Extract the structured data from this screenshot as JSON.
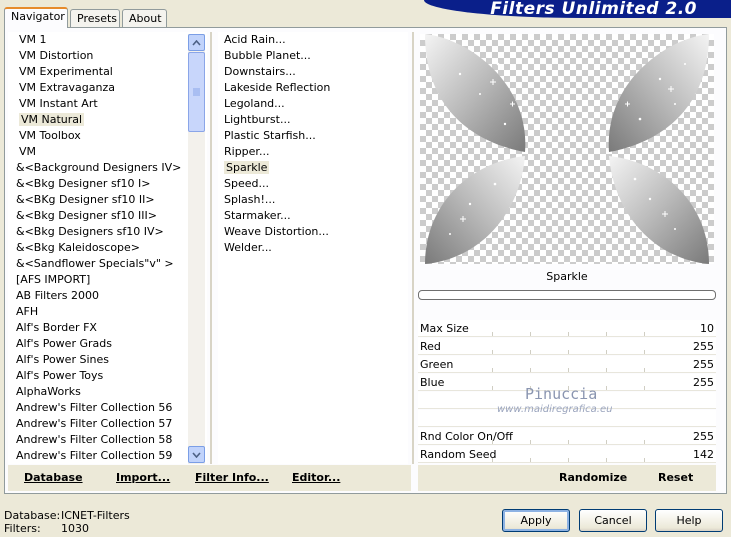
{
  "window": {
    "banner_title": "Filters Unlimited 2.0"
  },
  "tabs": [
    {
      "label": "Navigator",
      "active": true
    },
    {
      "label": "Presets",
      "active": false
    },
    {
      "label": "About",
      "active": false
    }
  ],
  "categories": {
    "items": [
      {
        "label": "VM 1"
      },
      {
        "label": "VM Distortion"
      },
      {
        "label": "VM Experimental"
      },
      {
        "label": "VM Extravaganza"
      },
      {
        "label": "VM Instant Art"
      },
      {
        "label": "VM Natural",
        "selected": true
      },
      {
        "label": "VM Toolbox"
      },
      {
        "label": "VM"
      },
      {
        "label": "&<Background Designers IV>"
      },
      {
        "label": "&<Bkg Designer sf10 I>"
      },
      {
        "label": "&<BKg Designer sf10 II>"
      },
      {
        "label": "&<Bkg Designer sf10 III>"
      },
      {
        "label": "&<Bkg Designers sf10 IV>"
      },
      {
        "label": "&<Bkg Kaleidoscope>"
      },
      {
        "label": "&<Sandflower Specials\"v\" >"
      },
      {
        "label": "[AFS IMPORT]"
      },
      {
        "label": "AB Filters 2000"
      },
      {
        "label": "AFH"
      },
      {
        "label": "Alf's Border FX"
      },
      {
        "label": "Alf's Power Grads"
      },
      {
        "label": "Alf's Power Sines"
      },
      {
        "label": "Alf's Power Toys"
      },
      {
        "label": "AlphaWorks"
      },
      {
        "label": "Andrew's Filter Collection 56"
      },
      {
        "label": "Andrew's Filter Collection 57"
      },
      {
        "label": "Andrew's Filter Collection 58"
      },
      {
        "label": "Andrew's Filter Collection 59"
      }
    ]
  },
  "filters": {
    "items": [
      {
        "label": "Acid Rain..."
      },
      {
        "label": "Bubble Planet..."
      },
      {
        "label": "Downstairs..."
      },
      {
        "label": "Lakeside Reflection"
      },
      {
        "label": "Legoland..."
      },
      {
        "label": "Lightburst..."
      },
      {
        "label": "Plastic Starfish..."
      },
      {
        "label": "Ripper..."
      },
      {
        "label": "Sparkle",
        "selected": true
      },
      {
        "label": "Speed..."
      },
      {
        "label": "Splash!..."
      },
      {
        "label": "Starmaker..."
      },
      {
        "label": "Weave Distortion..."
      },
      {
        "label": "Welder..."
      }
    ]
  },
  "preview": {
    "filter_name": "Sparkle"
  },
  "params": [
    {
      "label": "Max Size",
      "value": "10"
    },
    {
      "label": "Red",
      "value": "255"
    },
    {
      "label": "Green",
      "value": "255"
    },
    {
      "label": "Blue",
      "value": "255"
    },
    {
      "label": "",
      "value": ""
    },
    {
      "label": "",
      "value": ""
    },
    {
      "label": "Rnd Color On/Off",
      "value": "255"
    },
    {
      "label": "Random Seed",
      "value": "142"
    }
  ],
  "watermark": {
    "line1": "Pinuccia",
    "line2": "www.maidiregrafica.eu"
  },
  "toolbar": {
    "database": "Database",
    "import": "Import...",
    "filter_info": "Filter Info...",
    "editor": "Editor...",
    "randomize": "Randomize",
    "reset": "Reset"
  },
  "status": {
    "database_label": "Database:",
    "database_value": "ICNET-Filters",
    "filters_label": "Filters:",
    "filters_value": "1030"
  },
  "buttons": {
    "apply": "Apply",
    "cancel": "Cancel",
    "help": "Help"
  },
  "colors": {
    "banner": "#0a1f8a",
    "dialog_bg": "#ece9d8",
    "tab_accent": "#e68b2c"
  }
}
